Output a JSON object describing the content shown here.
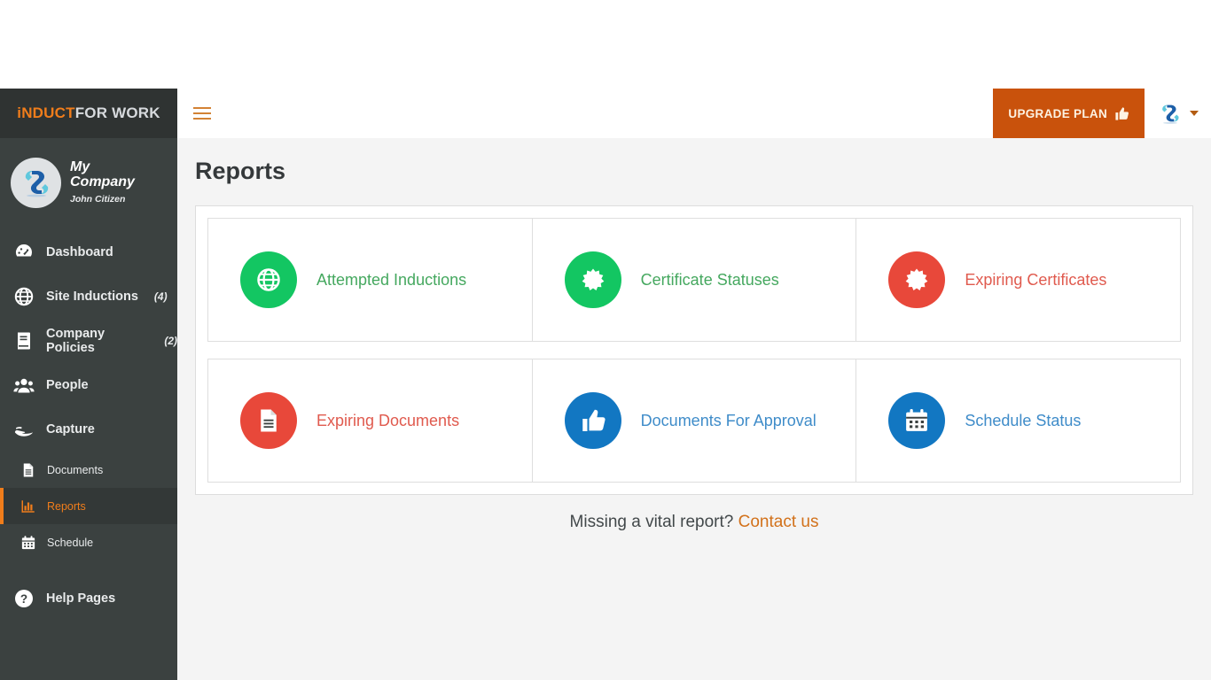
{
  "brand": {
    "part1": "iNDUCT",
    "part2": "FOR WORK"
  },
  "profile": {
    "company": "My Company",
    "user": "John Citizen",
    "avatar_icon": "company-logo-icon"
  },
  "sidebar": {
    "items": [
      {
        "label": "Dashboard",
        "icon": "dashboard-gauge-icon",
        "count": "",
        "level": "main",
        "active": false
      },
      {
        "label": "Site Inductions",
        "icon": "globe-icon",
        "count": "(4)",
        "level": "main",
        "active": false
      },
      {
        "label": "Company Policies",
        "icon": "book-icon",
        "count": "(2)",
        "level": "main",
        "active": false
      },
      {
        "label": "People",
        "icon": "people-icon",
        "count": "",
        "level": "main",
        "active": false
      },
      {
        "label": "Capture",
        "icon": "hand-capture-icon",
        "count": "",
        "level": "main",
        "active": false
      },
      {
        "label": "Documents",
        "icon": "document-icon",
        "count": "",
        "level": "sub",
        "active": false
      },
      {
        "label": "Reports",
        "icon": "bar-chart-icon",
        "count": "",
        "level": "sub",
        "active": true
      },
      {
        "label": "Schedule",
        "icon": "calendar-icon",
        "count": "",
        "level": "sub",
        "active": false
      },
      {
        "label": "Help Pages",
        "icon": "question-circle-icon",
        "count": "",
        "level": "main",
        "active": false
      }
    ]
  },
  "topbar": {
    "menu_toggle_icon": "hamburger-icon",
    "upgrade_label": "UPGRADE PLAN",
    "upgrade_icon": "thumbs-up-icon",
    "user_logo_icon": "company-logo-icon",
    "user_caret_icon": "chevron-down-icon"
  },
  "main": {
    "title": "Reports",
    "rows": [
      [
        {
          "label": "Attempted Inductions",
          "icon": "globe-icon",
          "circle_color": "#13c662",
          "text_color": "#45a85f"
        },
        {
          "label": "Certificate Statuses",
          "icon": "certificate-icon",
          "circle_color": "#13c662",
          "text_color": "#45a85f"
        },
        {
          "label": "Expiring Certificates",
          "icon": "certificate-icon",
          "circle_color": "#e8483a",
          "text_color": "#e05a4e"
        }
      ],
      [
        {
          "label": "Expiring Documents",
          "icon": "document-icon",
          "circle_color": "#e8483a",
          "text_color": "#e05a4e"
        },
        {
          "label": "Documents For Approval",
          "icon": "thumbs-up-icon",
          "circle_color": "#1277c2",
          "text_color": "#3f8cc9"
        },
        {
          "label": "Schedule Status",
          "icon": "calendar-icon",
          "circle_color": "#1277c2",
          "text_color": "#3f8cc9"
        }
      ]
    ],
    "footer_text": "Missing a vital report?",
    "footer_link": "Contact us"
  },
  "colors": {
    "accent_orange": "#f07d1b",
    "upgrade_bg": "#c9520c",
    "green": "#13c662",
    "red": "#e8483a",
    "blue": "#1277c2",
    "sidebar_bg": "#3b4140",
    "page_bg": "#f4f4f4"
  }
}
